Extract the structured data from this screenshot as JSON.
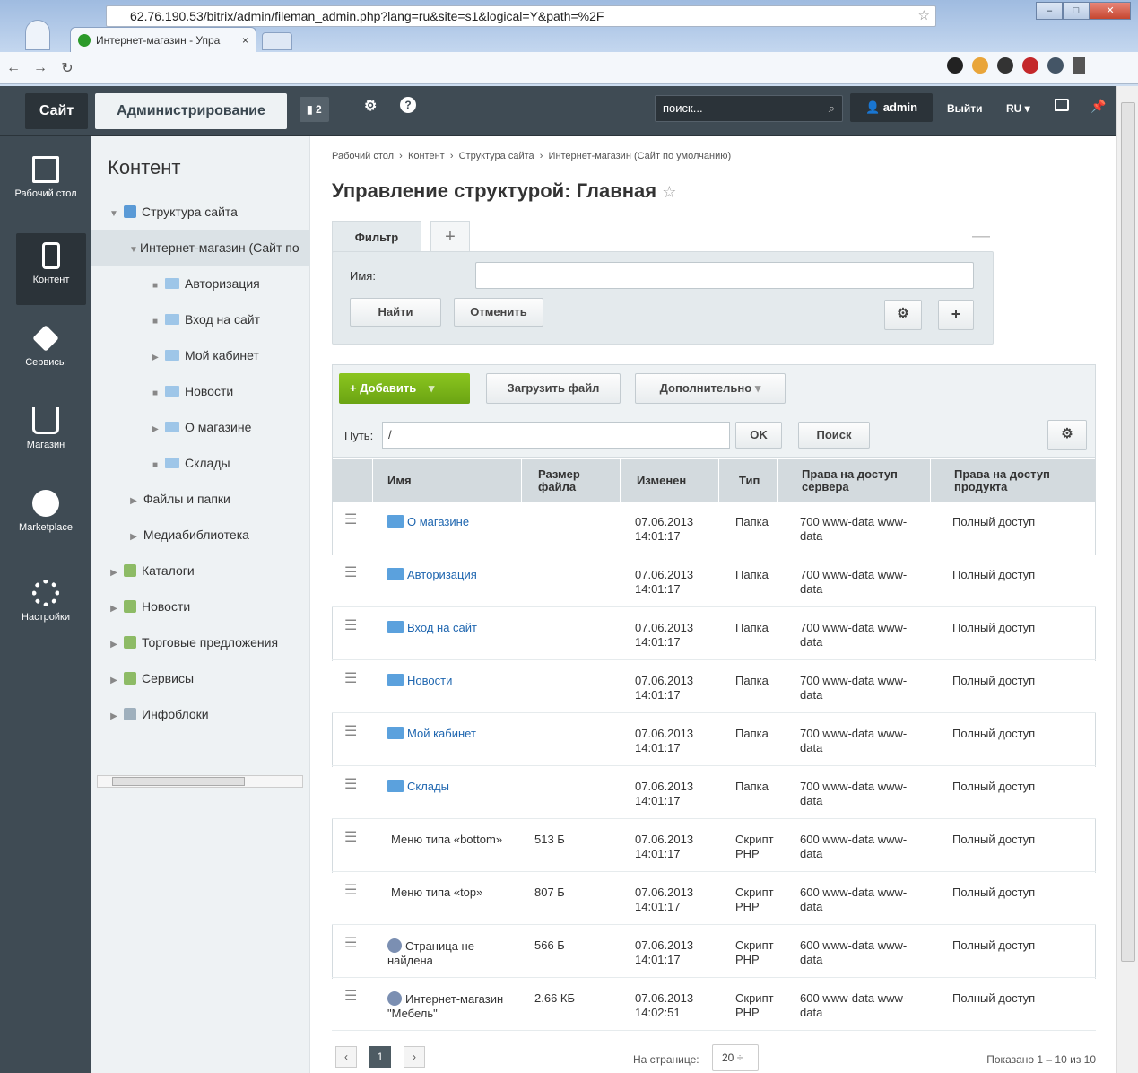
{
  "browser": {
    "tab_title": "Интернет-магазин - Упра",
    "tab_close": "×",
    "url": "62.76.190.53/bitrix/admin/fileman_admin.php?lang=ru&site=s1&logical=Y&path=%2F"
  },
  "panel": {
    "site": "Сайт",
    "admin": "Администрирование",
    "notifications": "2",
    "search_placeholder": "поиск...",
    "user": "admin",
    "exit": "Выйти",
    "lang": "RU"
  },
  "leftmenu": [
    {
      "label": "Рабочий стол"
    },
    {
      "label": "Контент"
    },
    {
      "label": "Сервисы"
    },
    {
      "label": "Магазин"
    },
    {
      "label": "Marketplace"
    },
    {
      "label": "Настройки"
    }
  ],
  "tree": {
    "title": "Контент",
    "nodes": [
      {
        "label": "Структура сайта"
      },
      {
        "label": "Интернет-магазин (Сайт по"
      },
      {
        "label": "Авторизация"
      },
      {
        "label": "Вход на сайт"
      },
      {
        "label": "Мой кабинет"
      },
      {
        "label": "Новости"
      },
      {
        "label": "О магазине"
      },
      {
        "label": "Склады"
      },
      {
        "label": "Файлы и папки"
      },
      {
        "label": "Медиабиблиотека"
      },
      {
        "label": "Каталоги"
      },
      {
        "label": "Новости"
      },
      {
        "label": "Торговые предложения"
      },
      {
        "label": "Сервисы"
      },
      {
        "label": "Инфоблоки"
      }
    ]
  },
  "breadcrumb": [
    "Рабочий стол",
    "Контент",
    "Структура сайта",
    "Интернет-магазин (Сайт по умолчанию)"
  ],
  "page_title": "Управление структурой: Главная",
  "filter": {
    "tab": "Фильтр",
    "name_label": "Имя:",
    "find": "Найти",
    "cancel": "Отменить"
  },
  "toolbar": {
    "add": "Добавить",
    "upload": "Загрузить файл",
    "more": "Дополнительно",
    "path_label": "Путь:",
    "path_value": "/",
    "ok": "OK",
    "search": "Поиск"
  },
  "table": {
    "headers": [
      "Имя",
      "Размер файла",
      "Изменен",
      "Тип",
      "Права на доступ сервера",
      "Права на доступ продукта"
    ],
    "rows": [
      {
        "name": "О магазине",
        "size": "",
        "date": "07.06.2013 14:01:17",
        "type": "Папка",
        "srv": "700 www-data www-data",
        "prod": "Полный доступ"
      },
      {
        "name": "Авторизация",
        "size": "",
        "date": "07.06.2013 14:01:17",
        "type": "Папка",
        "srv": "700 www-data www-data",
        "prod": "Полный доступ"
      },
      {
        "name": "Вход на сайт",
        "size": "",
        "date": "07.06.2013 14:01:17",
        "type": "Папка",
        "srv": "700 www-data www-data",
        "prod": "Полный доступ"
      },
      {
        "name": "Новости",
        "size": "",
        "date": "07.06.2013 14:01:17",
        "type": "Папка",
        "srv": "700 www-data www-data",
        "prod": "Полный доступ"
      },
      {
        "name": "Мой кабинет",
        "size": "",
        "date": "07.06.2013 14:01:17",
        "type": "Папка",
        "srv": "700 www-data www-data",
        "prod": "Полный доступ"
      },
      {
        "name": "Склады",
        "size": "",
        "date": "07.06.2013 14:01:17",
        "type": "Папка",
        "srv": "700 www-data www-data",
        "prod": "Полный доступ"
      },
      {
        "name": "Меню типа «bottom»",
        "size": "513 Б",
        "date": "07.06.2013 14:01:17",
        "type": "Скрипт PHP",
        "srv": "600 www-data www-data",
        "prod": "Полный доступ"
      },
      {
        "name": "Меню типа «top»",
        "size": "807 Б",
        "date": "07.06.2013 14:01:17",
        "type": "Скрипт PHP",
        "srv": "600 www-data www-data",
        "prod": "Полный доступ"
      },
      {
        "name": "Страница не найдена",
        "size": "566 Б",
        "date": "07.06.2013 14:01:17",
        "type": "Скрипт PHP",
        "srv": "600 www-data www-data",
        "prod": "Полный доступ"
      },
      {
        "name": "Интернет-магазин \"Мебель\"",
        "size": "2.66 КБ",
        "date": "07.06.2013 14:02:51",
        "type": "Скрипт PHP",
        "srv": "600 www-data www-data",
        "prod": "Полный доступ"
      }
    ]
  },
  "pager": {
    "current": "1",
    "per_page_label": "На странице:",
    "per_page": "20",
    "shown": "Показано 1 – 10 из 10"
  }
}
